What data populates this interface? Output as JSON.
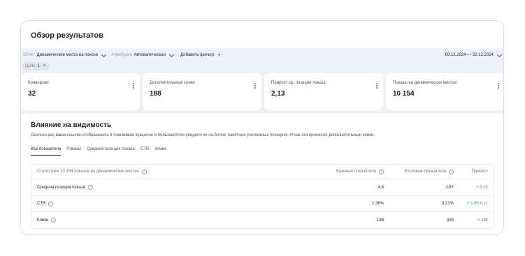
{
  "header": {
    "title": "Обзор результатов"
  },
  "filters": {
    "report": {
      "label": "Отчёт",
      "value": "Динамические места на поиске"
    },
    "attribution": {
      "label": "Атрибуция",
      "value": "Автоматическая"
    },
    "add_filter": "Добавить фильтр",
    "date_range": "09.12.2024 — 22.12.2024",
    "goals_chip": {
      "label": "Цели",
      "value": "1"
    }
  },
  "cards": [
    {
      "title": "Конверсии",
      "value": "32"
    },
    {
      "title": "Дополнительные клики",
      "value": "188"
    },
    {
      "title": "Прирост ср. позиции показа",
      "value": "2,13"
    },
    {
      "title": "Показы на динамических местах",
      "value": "10 154"
    }
  ],
  "visibility": {
    "title": "Влияние на видимость",
    "description": "Сколько раз ваши ссылки отобразились в поисковом аукционе и пользователи увидели их на более заметных рекламных позициях. И как это принесло дополнительные клики.",
    "tabs": [
      "Все показатели",
      "Показы",
      "Средняя позиция показа",
      "CTR",
      "Клики"
    ],
    "table": {
      "headers": [
        "Статистика 10 154 показов на динамических местах",
        "Базовые показатели",
        "Итоговые показатели",
        "Прирост"
      ],
      "rows": [
        {
          "name": "Средняя позиция показа",
          "base": "4,8",
          "final": "2,67",
          "growth": "+ 2,13"
        },
        {
          "name": "CTR",
          "base": "1,36%",
          "final": "3,21%",
          "growth": "+ 1,85 п. п."
        },
        {
          "name": "Клики",
          "base": "138",
          "final": "326",
          "growth": "+ 188"
        }
      ]
    }
  },
  "colors": {
    "positive": "#2aa44f",
    "panel_bg": "#eef1f7",
    "border": "#d9dde6"
  }
}
